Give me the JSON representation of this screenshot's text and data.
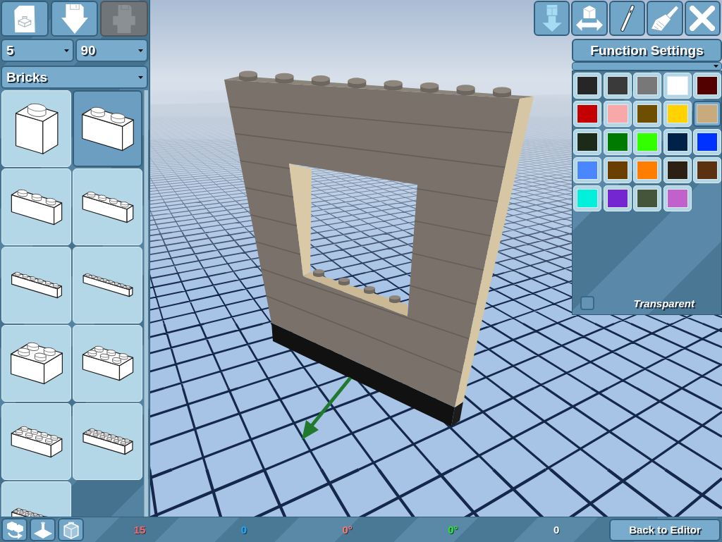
{
  "file_buttons": [
    {
      "disabled": false
    },
    {
      "disabled": false
    },
    {
      "disabled": true
    }
  ],
  "size_dropdown": {
    "value": "5"
  },
  "angle_dropdown": {
    "value": "90"
  },
  "category_dropdown": {
    "value": "Bricks"
  },
  "bricks": [
    {
      "selected": false
    },
    {
      "selected": true
    },
    {
      "selected": false
    },
    {
      "selected": false
    },
    {
      "selected": false
    },
    {
      "selected": false
    },
    {
      "selected": false
    },
    {
      "selected": false
    },
    {
      "selected": false
    },
    {
      "selected": false
    },
    {
      "selected": false
    }
  ],
  "tools": [
    {
      "selected": true
    },
    {
      "selected": false
    },
    {
      "selected": false
    },
    {
      "selected": false
    },
    {
      "selected": false
    }
  ],
  "function_settings": {
    "title": "Function Settings"
  },
  "palette": [
    {
      "color": "#262626",
      "selected": false
    },
    {
      "color": "#3a3a3a",
      "selected": false
    },
    {
      "color": "#787878",
      "selected": false
    },
    {
      "color": "#ffffff",
      "selected": false
    },
    {
      "color": "#520000",
      "selected": false
    },
    {
      "color": "#c40000",
      "selected": false
    },
    {
      "color": "#f8a8a8",
      "selected": false
    },
    {
      "color": "#6e4e00",
      "selected": false
    },
    {
      "color": "#ffd200",
      "selected": false
    },
    {
      "color": "#c8aa7c",
      "selected": true
    },
    {
      "color": "#1c2a1a",
      "selected": false
    },
    {
      "color": "#007a00",
      "selected": false
    },
    {
      "color": "#33ff00",
      "selected": false
    },
    {
      "color": "#002248",
      "selected": false
    },
    {
      "color": "#0032ff",
      "selected": false
    },
    {
      "color": "#4a86ff",
      "selected": false
    },
    {
      "color": "#6a3e00",
      "selected": false
    },
    {
      "color": "#ff7e00",
      "selected": false
    },
    {
      "color": "#2c2014",
      "selected": false
    },
    {
      "color": "#5a3212",
      "selected": false
    },
    {
      "color": "#00f0dc",
      "selected": false
    },
    {
      "color": "#7426d0",
      "selected": false
    },
    {
      "color": "#44553a",
      "selected": false
    },
    {
      "color": "#c260cc",
      "selected": false
    }
  ],
  "transparent": {
    "label": "Transparent",
    "checked": false
  },
  "readouts": [
    {
      "text": "15",
      "color": "#ff6464"
    },
    {
      "text": "0",
      "color": "#1eaaff"
    },
    {
      "text": "0°",
      "color": "#ff786c"
    },
    {
      "text": "0°",
      "color": "#22ee22"
    },
    {
      "text": "0",
      "color": "#ffffff"
    }
  ],
  "back_button": {
    "label": "Back to Editor"
  }
}
